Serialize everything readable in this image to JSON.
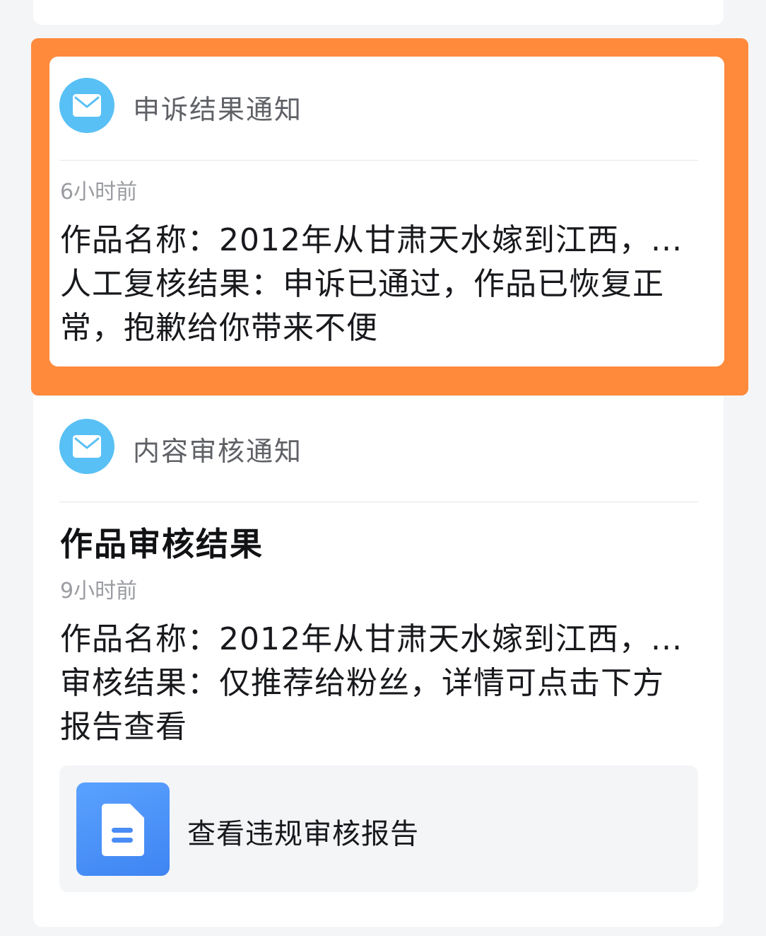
{
  "previous_card": {},
  "appeal_notice": {
    "section_title": "申诉结果通知",
    "time": "6小时前",
    "lines": [
      "作品名称：2012年从甘肃天水嫁到江西，...",
      "人工复核结果：申诉已通过，作品已恢复正",
      "常，抱歉给你带来不便"
    ],
    "icon": "mail-icon",
    "highlight_color": "#ff8a3c"
  },
  "review_notice": {
    "section_title": "内容审核通知",
    "headline": "作品审核结果",
    "time": "9小时前",
    "lines": [
      "作品名称：2012年从甘肃天水嫁到江西，...",
      "审核结果：仅推荐给粉丝，详情可点击下方",
      "报告查看"
    ],
    "icon": "mail-icon",
    "report": {
      "label": "查看违规审核报告",
      "icon": "document-icon"
    }
  },
  "colors": {
    "accent_icon_bg": "#58c0f5",
    "report_icon_bg": "#3f84f2"
  }
}
